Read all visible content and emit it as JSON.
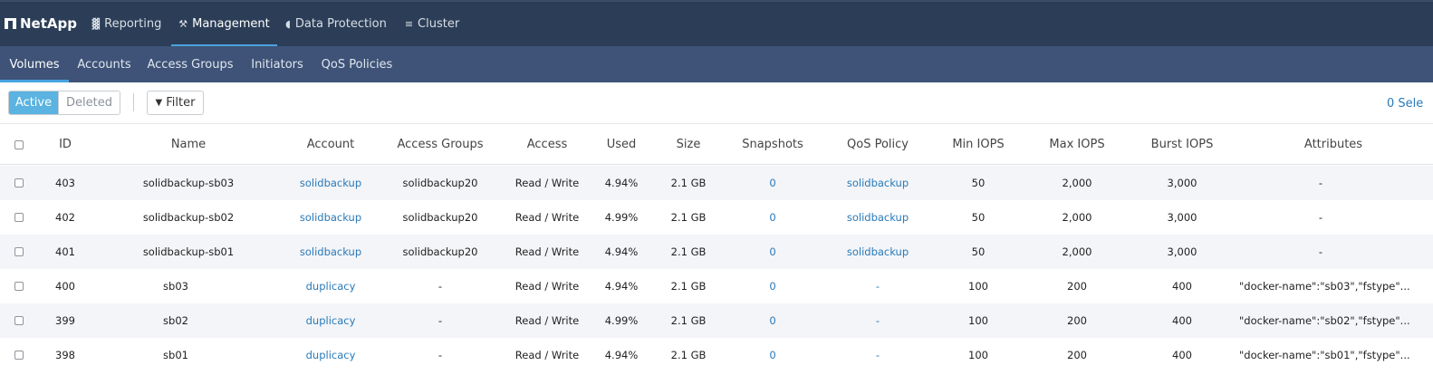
{
  "brand": {
    "name": "NetApp"
  },
  "topnav": [
    {
      "label": "Reporting",
      "icon": "bar-chart-icon",
      "glyph": "▓"
    },
    {
      "label": "Management",
      "icon": "wrench-icon",
      "glyph": "⚒"
    },
    {
      "label": "Data Protection",
      "icon": "shield-icon",
      "glyph": "◖"
    },
    {
      "label": "Cluster",
      "icon": "server-icon",
      "glyph": "≡"
    }
  ],
  "subnav": [
    "Volumes",
    "Accounts",
    "Access Groups",
    "Initiators",
    "QoS Policies"
  ],
  "toolbar": {
    "active": "Active",
    "deleted": "Deleted",
    "filter": "Filter",
    "selected": "0 Sele"
  },
  "columns": [
    "ID",
    "Name",
    "Account",
    "Access Groups",
    "Access",
    "Used",
    "Size",
    "Snapshots",
    "QoS Policy",
    "Min IOPS",
    "Max IOPS",
    "Burst IOPS",
    "Attributes"
  ],
  "rows": [
    {
      "id": "403",
      "name": "solidbackup-sb03",
      "account": "solidbackup",
      "access_groups": "solidbackup20",
      "access": "Read / Write",
      "used": "4.94%",
      "size": "2.1 GB",
      "snapshots": "0",
      "qos": "solidbackup",
      "min_iops": "50",
      "max_iops": "2,000",
      "burst_iops": "3,000",
      "attributes": "-"
    },
    {
      "id": "402",
      "name": "solidbackup-sb02",
      "account": "solidbackup",
      "access_groups": "solidbackup20",
      "access": "Read / Write",
      "used": "4.99%",
      "size": "2.1 GB",
      "snapshots": "0",
      "qos": "solidbackup",
      "min_iops": "50",
      "max_iops": "2,000",
      "burst_iops": "3,000",
      "attributes": "-"
    },
    {
      "id": "401",
      "name": "solidbackup-sb01",
      "account": "solidbackup",
      "access_groups": "solidbackup20",
      "access": "Read / Write",
      "used": "4.94%",
      "size": "2.1 GB",
      "snapshots": "0",
      "qos": "solidbackup",
      "min_iops": "50",
      "max_iops": "2,000",
      "burst_iops": "3,000",
      "attributes": "-"
    },
    {
      "id": "400",
      "name": "sb03",
      "account": "duplicacy",
      "access_groups": "-",
      "access": "Read / Write",
      "used": "4.94%",
      "size": "2.1 GB",
      "snapshots": "0",
      "qos": "-",
      "min_iops": "100",
      "max_iops": "200",
      "burst_iops": "400",
      "attributes": "\"docker-name\":\"sb03\",\"fstype\"..."
    },
    {
      "id": "399",
      "name": "sb02",
      "account": "duplicacy",
      "access_groups": "-",
      "access": "Read / Write",
      "used": "4.99%",
      "size": "2.1 GB",
      "snapshots": "0",
      "qos": "-",
      "min_iops": "100",
      "max_iops": "200",
      "burst_iops": "400",
      "attributes": "\"docker-name\":\"sb02\",\"fstype\"..."
    },
    {
      "id": "398",
      "name": "sb01",
      "account": "duplicacy",
      "access_groups": "-",
      "access": "Read / Write",
      "used": "4.94%",
      "size": "2.1 GB",
      "snapshots": "0",
      "qos": "-",
      "min_iops": "100",
      "max_iops": "200",
      "burst_iops": "400",
      "attributes": "\"docker-name\":\"sb01\",\"fstype\"..."
    }
  ],
  "colors": {
    "topnav": "#2c3e57",
    "subnav": "#3e5377",
    "accent": "#4aa3df",
    "link": "#2a7ab8",
    "active_button": "#5ab3e0"
  }
}
